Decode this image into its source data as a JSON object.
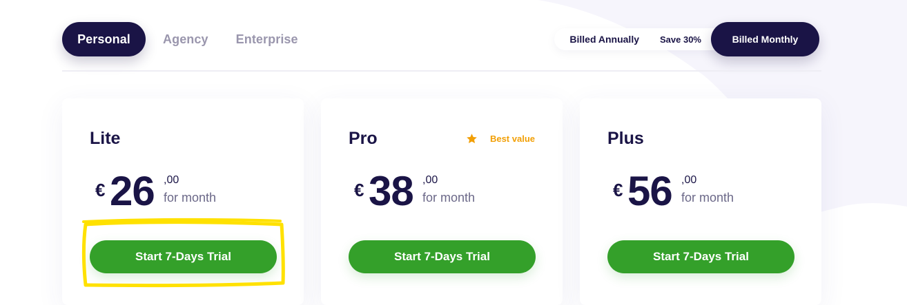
{
  "plan_tabs": [
    {
      "label": "Personal",
      "active": true
    },
    {
      "label": "Agency",
      "active": false
    },
    {
      "label": "Enterprise",
      "active": false
    }
  ],
  "billing": {
    "annually_label": "Billed Annually",
    "save_label": "Save 30%",
    "monthly_label": "Billed Monthly",
    "selected": "Billed Monthly"
  },
  "plans": [
    {
      "name": "Lite",
      "currency": "€",
      "amount": "26",
      "cents": ",00",
      "period": "for month",
      "cta_label": "Start 7-Days Trial"
    },
    {
      "name": "Pro",
      "badge_label": "Best value",
      "badge_icon": "star-icon",
      "currency": "€",
      "amount": "38",
      "cents": ",00",
      "period": "for month",
      "cta_label": "Start 7-Days Trial"
    },
    {
      "name": "Plus",
      "currency": "€",
      "amount": "56",
      "cents": ",00",
      "period": "for month",
      "cta_label": "Start 7-Days Trial"
    }
  ],
  "colors": {
    "navy": "#1a1446",
    "green": "#34a02a",
    "badge_orange": "#f29f05",
    "highlight_yellow": "#ffe100"
  }
}
